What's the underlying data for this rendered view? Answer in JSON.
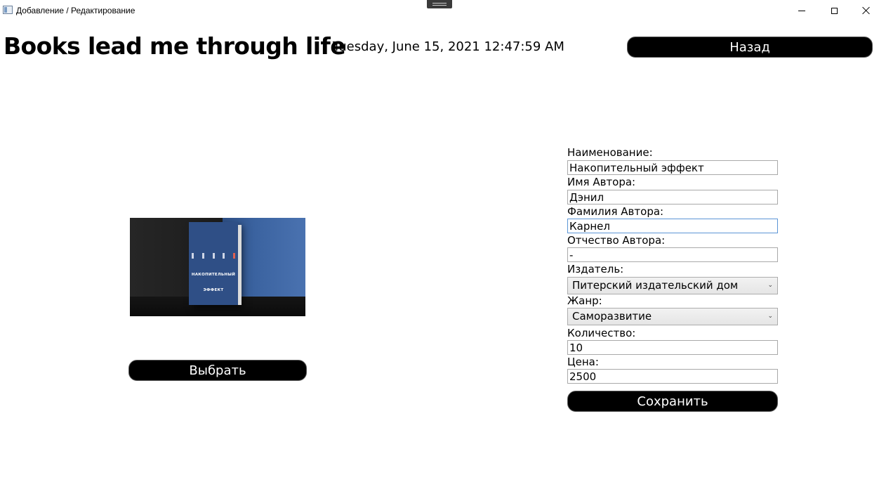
{
  "window": {
    "title": "Добавление / Редактирование"
  },
  "header": {
    "app_title": "Books lead me through life",
    "datetime": "Tuesday, June 15, 2021 12:47:59 AM",
    "back_label": "Назад"
  },
  "image_panel": {
    "book_title_line1": "НАКОПИТЕЛЬНЫЙ",
    "book_title_line2": "ЭФФЕКТ",
    "choose_label": "Выбрать"
  },
  "form": {
    "name_label": "Наименование:",
    "name_value": "Накопительный эффект",
    "author_first_label": "Имя Автора:",
    "author_first_value": "Дэнил",
    "author_last_label": "Фамилия Автора:",
    "author_last_value": "Карнел",
    "author_middle_label": "Отчество Автора:",
    "author_middle_value": "-",
    "publisher_label": "Издатель:",
    "publisher_value": "Питерский издательский дом",
    "genre_label": "Жанр:",
    "genre_value": "Саморазвитие",
    "quantity_label": "Количество:",
    "quantity_value": "10",
    "price_label": "Цена:",
    "price_value": "2500",
    "save_label": "Сохранить"
  },
  "colors": {
    "button_bg": "#000000",
    "button_text": "#ffffff",
    "focus_border": "#5b95d6"
  },
  "icons": {
    "app": "window-app-icon",
    "minimize": "minimize-icon",
    "maximize": "maximize-icon",
    "close": "close-icon",
    "dropdown": "chevron-down-icon"
  }
}
